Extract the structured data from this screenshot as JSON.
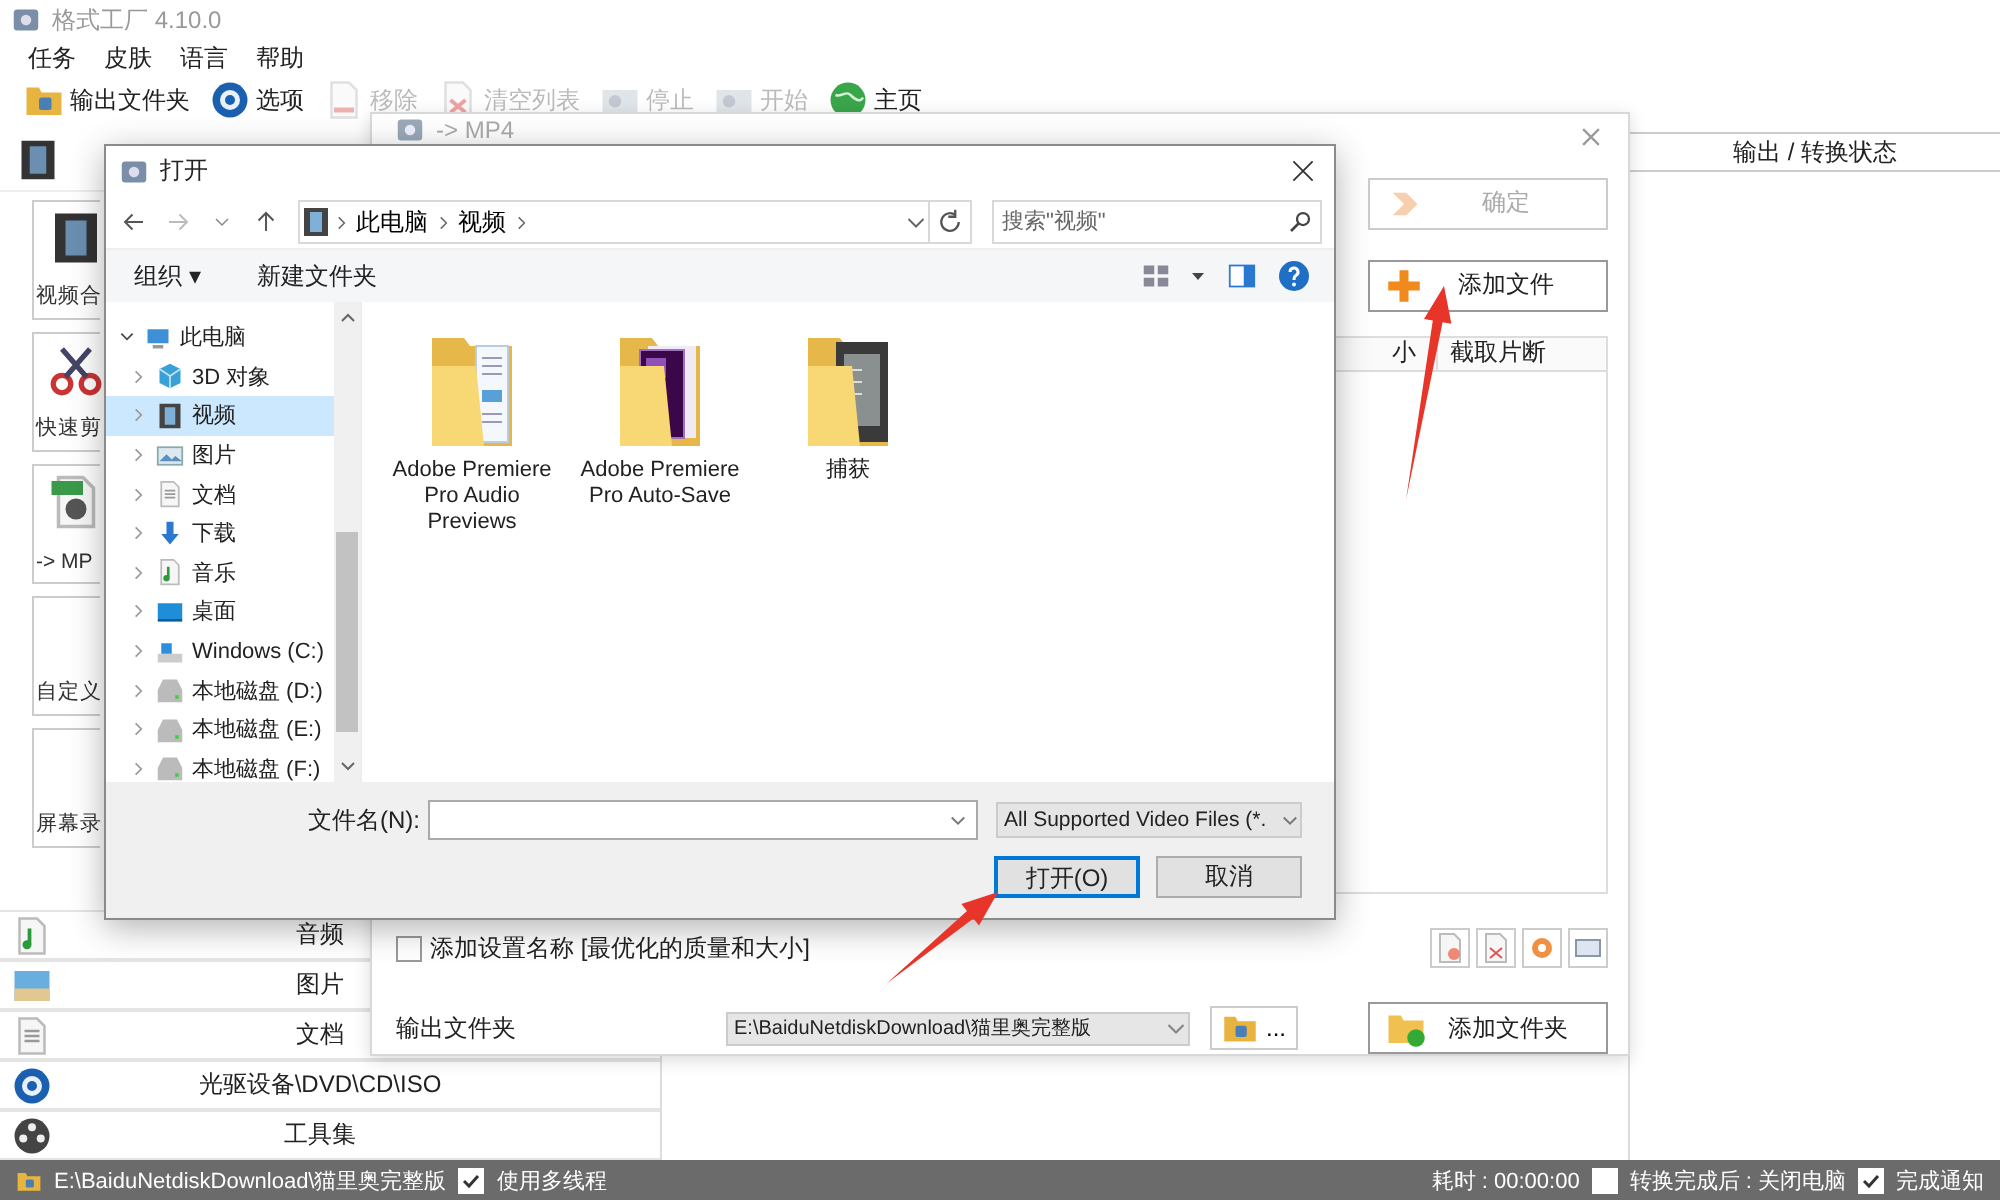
{
  "window": {
    "title": "格式工厂 4.10.0"
  },
  "menu": [
    "任务",
    "皮肤",
    "语言",
    "帮助"
  ],
  "toolbar": [
    {
      "label": "输出文件夹",
      "kind": "folder",
      "disabled": false
    },
    {
      "label": "选项",
      "kind": "disc",
      "disabled": false
    },
    {
      "label": "移除",
      "kind": "page",
      "disabled": true
    },
    {
      "label": "清空列表",
      "kind": "page-x",
      "disabled": true
    },
    {
      "label": "停止",
      "kind": "camera",
      "disabled": true
    },
    {
      "label": "开始",
      "kind": "camera",
      "disabled": true
    },
    {
      "label": "主页",
      "kind": "globe",
      "disabled": false
    }
  ],
  "sidebar": {
    "tiles": [
      {
        "label": "视频合",
        "kind": "film"
      },
      {
        "label": "快速剪",
        "kind": "cut"
      },
      {
        "label": "-> MP",
        "kind": "mp4"
      },
      {
        "label": "自定义",
        "kind": "plain"
      },
      {
        "label": "屏幕录",
        "kind": "plain"
      }
    ],
    "categories": [
      {
        "label": "音频",
        "kind": "music"
      },
      {
        "label": "图片",
        "kind": "landscape"
      },
      {
        "label": "文档",
        "kind": "document"
      },
      {
        "label": "光驱设备\\DVD\\CD\\ISO",
        "kind": "disc"
      },
      {
        "label": "工具集",
        "kind": "reel"
      }
    ]
  },
  "status_panel": {
    "title": "输出 / 转换状态"
  },
  "convert_dialog": {
    "title": "-> MP4",
    "buttons": [
      {
        "label": "确定",
        "disabled": true
      },
      {
        "label": "添加文件",
        "disabled": false
      }
    ],
    "columns": [
      "小",
      "截取片断"
    ],
    "add_setting_name": {
      "label": "添加设置名称 [最优化的质量和大小]",
      "checked": false
    },
    "output_folder": {
      "label": "输出文件夹",
      "value": "E:\\BaiduNetdiskDownload\\猫里奥完整版"
    },
    "browse_label": "...",
    "add_folder_button": "添加文件夹"
  },
  "open_dialog": {
    "title": "打开",
    "path": [
      "此电脑",
      "视频"
    ],
    "search": {
      "placeholder": "搜索\"视频\""
    },
    "commands": [
      "组织 ▾",
      "新建文件夹"
    ],
    "tree": [
      {
        "label": "此电脑",
        "kind": "pc",
        "expanded": true,
        "selected": false,
        "children": [
          {
            "label": "3D 对象",
            "kind": "cube",
            "expanded": false,
            "selected": false
          },
          {
            "label": "视频",
            "kind": "video",
            "expanded": false,
            "selected": true
          },
          {
            "label": "图片",
            "kind": "picture",
            "expanded": false,
            "selected": false
          },
          {
            "label": "文档",
            "kind": "document",
            "expanded": false,
            "selected": false
          },
          {
            "label": "下载",
            "kind": "download",
            "expanded": false,
            "selected": false
          },
          {
            "label": "音乐",
            "kind": "music",
            "expanded": false,
            "selected": false
          },
          {
            "label": "桌面",
            "kind": "desktop",
            "expanded": false,
            "selected": false
          },
          {
            "label": "Windows (C:)",
            "kind": "windows",
            "expanded": false,
            "selected": false
          },
          {
            "label": "本地磁盘 (D:)",
            "kind": "disk",
            "expanded": false,
            "selected": false
          },
          {
            "label": "本地磁盘 (E:)",
            "kind": "disk",
            "expanded": false,
            "selected": false
          },
          {
            "label": "本地磁盘 (F:)",
            "kind": "disk",
            "expanded": false,
            "selected": false
          }
        ]
      }
    ],
    "files": [
      {
        "name": "Adobe Premiere Pro Audio Previews",
        "kind": "audio"
      },
      {
        "name": "Adobe Premiere Pro Auto-Save",
        "kind": "premiere"
      },
      {
        "name": "捕获",
        "kind": "capture"
      }
    ],
    "filename_label": "文件名(N):",
    "filter": "All Supported Video Files (*.",
    "buttons": [
      {
        "label": "打开(O)",
        "default": true
      },
      {
        "label": "取消",
        "default": false
      }
    ]
  },
  "status_bar": {
    "path": "E:\\BaiduNetdiskDownload\\猫里奥完整版",
    "multithread": {
      "label": "使用多线程",
      "checked": true
    },
    "elapsed": "耗时 : 00:00:00",
    "shutdown": {
      "label": "转换完成后 : 关闭电脑",
      "checked": false
    },
    "notify": {
      "label": "完成通知",
      "checked": true
    }
  }
}
